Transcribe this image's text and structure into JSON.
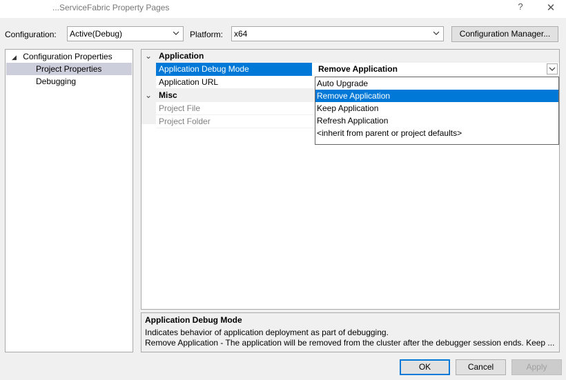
{
  "window": {
    "title": "...ServiceFabric Property Pages",
    "help_label": "?",
    "close_label": "✕"
  },
  "toolbar": {
    "configuration_label": "Configuration:",
    "configuration_value": "Active(Debug)",
    "platform_label": "Platform:",
    "platform_value": "x64",
    "config_manager_label": "Configuration Manager..."
  },
  "tree": {
    "root": "Configuration Properties",
    "items": [
      {
        "label": "Project Properties",
        "selected": true
      },
      {
        "label": "Debugging",
        "selected": false
      }
    ]
  },
  "grid": {
    "categories": [
      {
        "name": "Application",
        "rows": [
          {
            "name": "Application Debug Mode",
            "value": "Remove Application"
          },
          {
            "name": "Application URL",
            "value": ""
          }
        ]
      },
      {
        "name": "Misc",
        "rows": [
          {
            "name": "Project File",
            "value": ""
          },
          {
            "name": "Project Folder",
            "value": ""
          }
        ]
      }
    ],
    "selected_value": "Remove Application"
  },
  "dropdown": {
    "options": [
      "Auto Upgrade",
      "Remove Application",
      "Keep Application",
      "Refresh Application",
      "<inherit from parent or project defaults>"
    ],
    "highlighted": "Remove Application"
  },
  "description": {
    "title": "Application Debug Mode",
    "line1": "Indicates behavior of application deployment as part of debugging.",
    "line2": "Remove Application - The application will be removed from the cluster after the debugger session ends. Keep ..."
  },
  "buttons": {
    "ok": "OK",
    "cancel": "Cancel",
    "apply": "Apply"
  },
  "colors": {
    "selection": "#0078d7",
    "tree_selection": "#cccedb"
  }
}
